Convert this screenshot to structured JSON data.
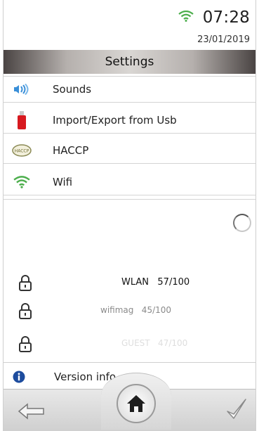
{
  "status": {
    "time": "07:28",
    "date": "23/01/2019"
  },
  "header": {
    "title": "Settings"
  },
  "menu": [
    {
      "label": "Sounds",
      "icon": "speaker-icon"
    },
    {
      "label": "Import/Export from Usb",
      "icon": "usb-drive-icon"
    },
    {
      "label": "HACCP",
      "icon": "haccp-icon"
    },
    {
      "label": "Wifi",
      "icon": "wifi-icon"
    }
  ],
  "networks": [
    {
      "name": "WLAN   57/100"
    },
    {
      "name": "wifimag   45/100"
    },
    {
      "name": "GUEST   47/100"
    }
  ],
  "version": {
    "label": "Version info"
  },
  "colors": {
    "wifi_green": "#4cae4c",
    "usb_red": "#d7191f",
    "info_blue": "#1d4c9e",
    "sound_blue": "#3a8fd8"
  }
}
